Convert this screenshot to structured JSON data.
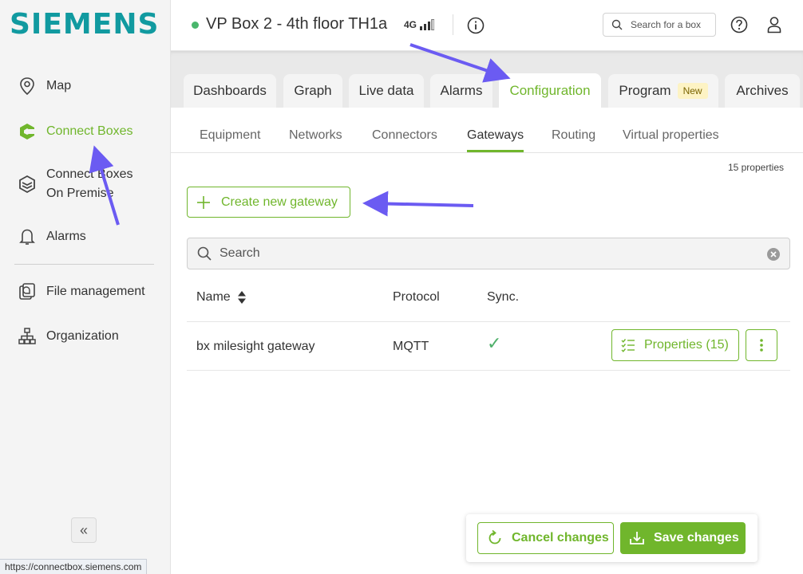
{
  "brand": {
    "logo_text": "SIEMENS",
    "color": "#119aa0"
  },
  "colors": {
    "accent": "#70b62c",
    "status_online": "#49b66c",
    "annotation_arrow": "#6b5bf2"
  },
  "sidebar": {
    "items": [
      {
        "label": "Map",
        "icon": "map-pin-icon"
      },
      {
        "label": "Connect Boxes",
        "icon": "connect-box-icon",
        "active": true
      },
      {
        "label_line1": "Connect Boxes",
        "label_line2": "On Premise",
        "icon": "on-premise-box-icon"
      },
      {
        "label": "Alarms",
        "icon": "bell-icon"
      },
      {
        "label": "File management",
        "icon": "file-management-icon"
      },
      {
        "label": "Organization",
        "icon": "org-chart-icon"
      }
    ],
    "collapse_glyph": "«"
  },
  "status_bar": {
    "url": "https://connectbox.siemens.com"
  },
  "header": {
    "box_title": "VP Box 2 - 4th floor TH1a",
    "network": "4G",
    "search_placeholder": "Search for a box"
  },
  "tabs": [
    {
      "label": "Dashboards"
    },
    {
      "label": "Graph"
    },
    {
      "label": "Live data"
    },
    {
      "label": "Alarms"
    },
    {
      "label": "Configuration",
      "active": true
    },
    {
      "label": "Program",
      "badge": "New"
    },
    {
      "label": "Archives"
    }
  ],
  "subtabs": [
    {
      "label": "Equipment"
    },
    {
      "label": "Networks"
    },
    {
      "label": "Connectors"
    },
    {
      "label": "Gateways",
      "active": true
    },
    {
      "label": "Routing"
    },
    {
      "label": "Virtual properties"
    }
  ],
  "content": {
    "properties_count": "15 properties",
    "create_button": "Create new gateway",
    "search_placeholder": "Search"
  },
  "table": {
    "columns": [
      "Name",
      "Protocol",
      "Sync."
    ],
    "rows": [
      {
        "name": "bx milesight gateway",
        "protocol": "MQTT",
        "sync": "✓",
        "properties_button": "Properties (15)"
      }
    ]
  },
  "actions": {
    "cancel": "Cancel changes",
    "save": "Save changes"
  }
}
